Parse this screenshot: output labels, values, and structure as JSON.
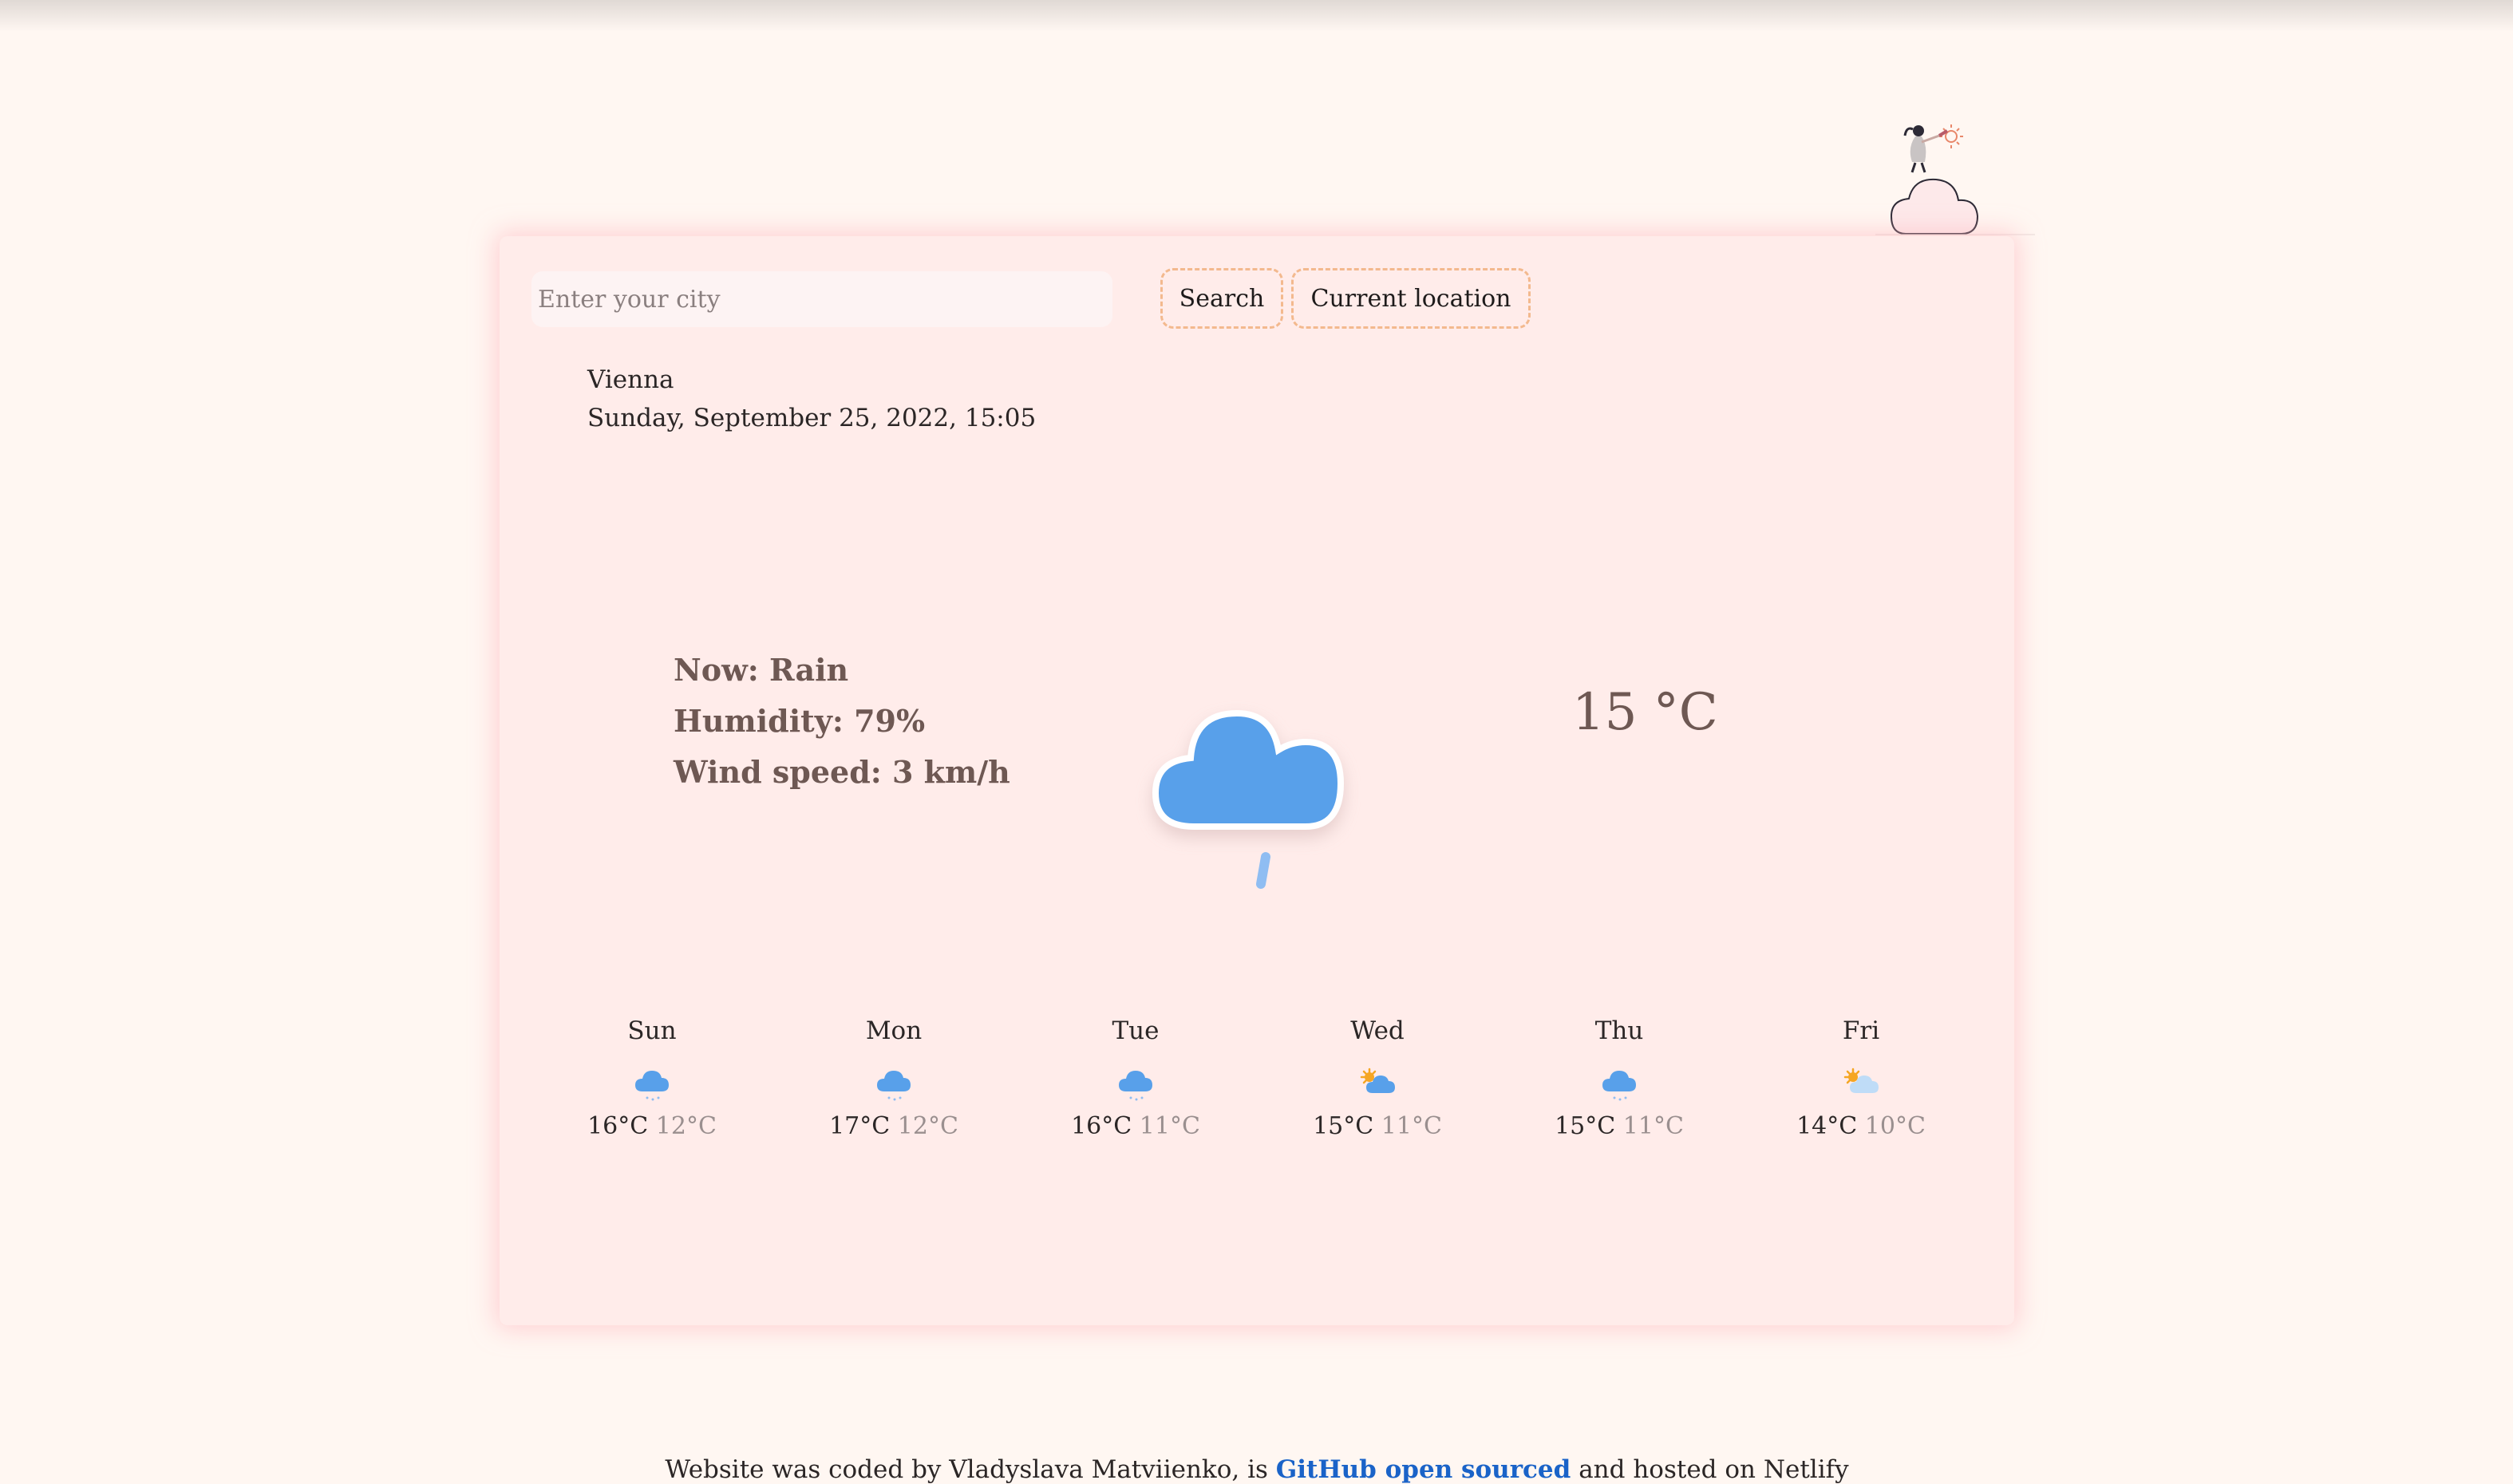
{
  "search": {
    "placeholder": "Enter your city",
    "value": "",
    "search_label": "Search",
    "location_label": "Current location"
  },
  "location": {
    "city": "Vienna",
    "datetime": "Sunday, September 25, 2022, 15:05"
  },
  "current": {
    "condition": "Now: Rain",
    "humidity": "Humidity: 79%",
    "wind": "Wind speed: 3 km/h",
    "temperature": "15 °C",
    "icon": "rain-cloud-icon"
  },
  "forecast": [
    {
      "day": "Sun",
      "max": "16°C",
      "min": "12°C",
      "icon": "rain-cloud-icon"
    },
    {
      "day": "Mon",
      "max": "17°C",
      "min": "12°C",
      "icon": "rain-cloud-icon"
    },
    {
      "day": "Tue",
      "max": "16°C",
      "min": "11°C",
      "icon": "rain-cloud-icon"
    },
    {
      "day": "Wed",
      "max": "15°C",
      "min": "11°C",
      "icon": "sun-cloud-icon"
    },
    {
      "day": "Thu",
      "max": "15°C",
      "min": "11°C",
      "icon": "rain-cloud-icon"
    },
    {
      "day": "Fri",
      "max": "14°C",
      "min": "10°C",
      "icon": "sun-light-cloud-icon"
    }
  ],
  "footer": {
    "prefix": "Website was coded by Vladyslava Matviienko, is",
    "link_text": "GitHub open sourced",
    "suffix": "and hosted on Netlify"
  },
  "colors": {
    "page_background": "#fff7f2",
    "card_background": "#ffecea",
    "button_border": "#f3b98e",
    "accent_text": "#6e5853",
    "link": "#1a63c8",
    "cloud_blue": "#58a0ea"
  }
}
